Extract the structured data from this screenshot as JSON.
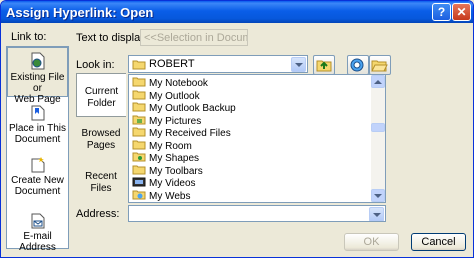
{
  "window": {
    "title": "Assign Hyperlink: Open"
  },
  "link_to": {
    "label": "Link to:",
    "items": [
      {
        "label_line1": "Existing File or",
        "label_line2": "Web Page",
        "icon": "globe-doc-icon",
        "selected": true
      },
      {
        "label_line1": "Place in This",
        "label_line2": "Document",
        "icon": "bookmark-doc-icon",
        "selected": false
      },
      {
        "label_line1": "Create New",
        "label_line2": "Document",
        "icon": "new-doc-icon",
        "selected": false
      },
      {
        "label_line1": "E-mail Address",
        "label_line2": "",
        "icon": "email-icon",
        "selected": false
      }
    ]
  },
  "text_to_display": {
    "label": "Text to display:",
    "value": "<<Selection in Document>>"
  },
  "look_in": {
    "label": "Look in:",
    "value": "ROBERT"
  },
  "nav_tabs": [
    {
      "label_line1": "Current",
      "label_line2": "Folder",
      "selected": true
    },
    {
      "label_line1": "Browsed",
      "label_line2": "Pages",
      "selected": false
    },
    {
      "label_line1": "Recent",
      "label_line2": "Files",
      "selected": false
    }
  ],
  "files": [
    "My Notebook",
    "My Outlook",
    "My Outlook Backup",
    "My Pictures",
    "My Received Files",
    "My Room",
    "My Shapes",
    "My Toolbars",
    "My Videos",
    "My Webs"
  ],
  "address": {
    "label": "Address:",
    "value": ""
  },
  "buttons": {
    "ok": "OK",
    "cancel": "Cancel"
  },
  "colors": {
    "titlebar": "#0a5bee",
    "dialog_bg": "#ece9d8",
    "folder": "#f5d76e"
  }
}
